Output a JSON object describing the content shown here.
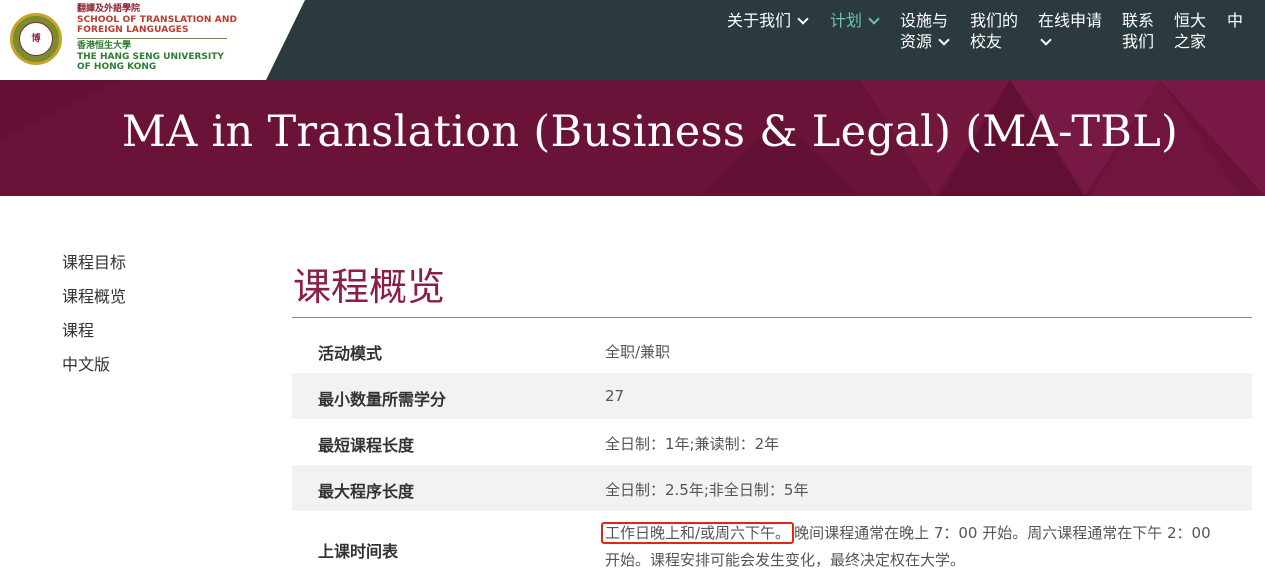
{
  "header": {
    "logo": {
      "zh_school": "翻譯及外語學院",
      "en_school_1": "SCHOOL OF TRANSLATION AND",
      "en_school_2": "FOREIGN LANGUAGES",
      "zh_university": "香港恒生大學",
      "en_university_1": "THE HANG SENG UNIVERSITY",
      "en_university_2": "OF HONG KONG"
    },
    "nav": [
      {
        "label": "关于我们"
      },
      {
        "label": "计划"
      },
      {
        "label_1": "设施与",
        "label_2": "资源"
      },
      {
        "label_1": "我们的",
        "label_2": "校友"
      },
      {
        "label": "在线申请"
      },
      {
        "label_1": "联系",
        "label_2": "我们"
      },
      {
        "label_1": "恒大",
        "label_2": "之家"
      },
      {
        "label": "中"
      }
    ]
  },
  "banner": {
    "title": "MA in Translation (Business & Legal) (MA-TBL)"
  },
  "sidebar": {
    "items": [
      {
        "label": "课程目标"
      },
      {
        "label": "课程概览"
      },
      {
        "label": "课程"
      },
      {
        "label": "中文版"
      }
    ]
  },
  "main": {
    "title": "课程概览",
    "rows": [
      {
        "label": "活动模式",
        "value": "全职/兼职"
      },
      {
        "label": "最小数量所需学分",
        "value": "27"
      },
      {
        "label": "最短课程长度",
        "value": "全日制：1年;兼读制：2年"
      },
      {
        "label": "最大程序长度",
        "value": "全日制：2.5年;非全日制：5年"
      },
      {
        "label": "上课时间表",
        "value_highlight": "工作日晚上和/或周六下午。",
        "value_rest": "晚间课程通常在晚上 7：00 开始。周六课程通常在下午 2：00 开始。课程安排可能会发生变化，最终决定权在大学。"
      }
    ]
  },
  "colors": {
    "header_bg": "#2b3a3e",
    "banner_bg": "#6b1239",
    "accent_title": "#8a1e4a",
    "active_nav": "#6fc3b4",
    "highlight_border": "#e0261b"
  }
}
